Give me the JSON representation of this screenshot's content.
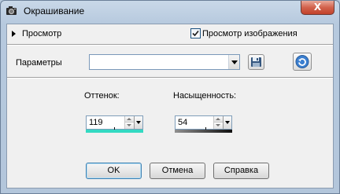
{
  "window": {
    "title": "Окрашивание",
    "close_glyph": "X"
  },
  "preview": {
    "label": "Просмотр",
    "checkbox_label": "Просмотр изображения",
    "checked": true
  },
  "params": {
    "label": "Параметры",
    "preset_value": ""
  },
  "hue": {
    "label": "Оттенок:",
    "value": "119",
    "bar_color": "#33d9c2"
  },
  "saturation": {
    "label": "Насыщенность:",
    "value": "54"
  },
  "buttons": {
    "ok": "OK",
    "cancel": "Отмена",
    "help": "Справка"
  }
}
